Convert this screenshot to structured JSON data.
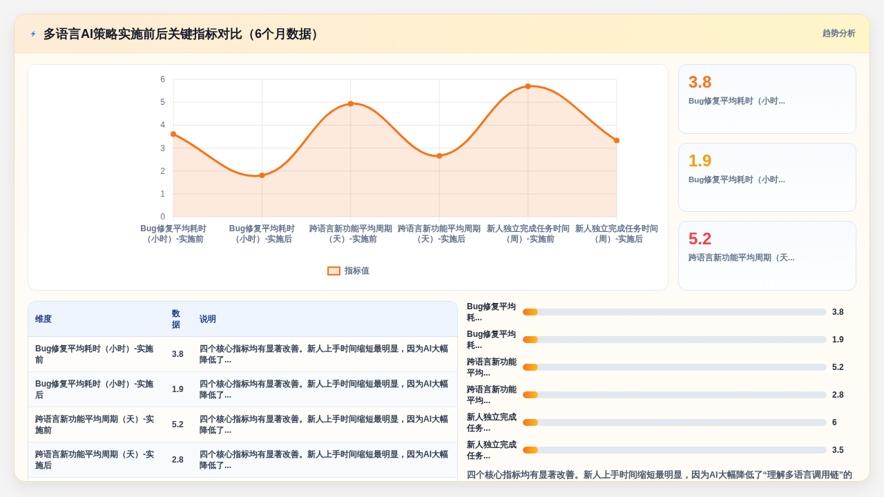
{
  "header": {
    "title": "多语言AI策略实施前后关键指标对比（6个月数据）",
    "tag": "趋势分析"
  },
  "chart": {
    "chart_data": {
      "type": "area",
      "categories": [
        "Bug修复平均耗时（小时）-实施前",
        "Bug修复平均耗时（小时）-实施后",
        "跨语言新功能平均周期（天）-实施前",
        "跨语言新功能平均周期（天）-实施后",
        "新人独立完成任务时间（周）-实施前",
        "新人独立完成任务时间（周）-实施后"
      ],
      "series": [
        {
          "name": "指标值",
          "color": "#f97316",
          "values": [
            3.61,
            1.81,
            4.94,
            2.66,
            5.7,
            3.33
          ]
        }
      ],
      "ylim": [
        0,
        6
      ],
      "yticks": [
        0,
        1,
        2,
        3,
        4,
        5,
        6
      ],
      "grid": true
    }
  },
  "kpis": [
    {
      "value": "3.8",
      "label": "Bug修复平均耗时（小时...",
      "color": "#f97316"
    },
    {
      "value": "1.9",
      "label": "Bug修复平均耗时（小时...",
      "color": "#f59e0b"
    },
    {
      "value": "5.2",
      "label": "跨语言新功能平均周期（天...",
      "color": "#ef4444"
    }
  ],
  "table": {
    "columns": [
      "维度",
      "数据",
      "说明"
    ],
    "rows": [
      {
        "dimension": "Bug修复平均耗时（小时）-实施前",
        "value": "3.8",
        "note": "四个核心指标均有显著改善。新人上手时间缩短最明显，因为AI大幅降低了..."
      },
      {
        "dimension": "Bug修复平均耗时（小时）-实施后",
        "value": "1.9",
        "note": "四个核心指标均有显著改善。新人上手时间缩短最明显，因为AI大幅降低了..."
      },
      {
        "dimension": "跨语言新功能平均周期（天）-实施前",
        "value": "5.2",
        "note": "四个核心指标均有显著改善。新人上手时间缩短最明显，因为AI大幅降低了..."
      },
      {
        "dimension": "跨语言新功能平均周期（天）-实施后",
        "value": "2.8",
        "note": "四个核心指标均有显著改善。新人上手时间缩短最明显，因为AI大幅降低了..."
      }
    ]
  },
  "bars": [
    {
      "label": "Bug修复平均耗...",
      "value": "3.8",
      "level": 0.05
    },
    {
      "label": "Bug修复平均耗...",
      "value": "1.9",
      "level": 0.05
    },
    {
      "label": "跨语言新功能平均...",
      "value": "5.2",
      "level": 0.05
    },
    {
      "label": "跨语言新功能平均...",
      "value": "2.8",
      "level": 0.05
    },
    {
      "label": "新人独立完成任务...",
      "value": "6",
      "level": 0.05
    },
    {
      "label": "新人独立完成任务...",
      "value": "3.5",
      "level": 0.05
    }
  ],
  "summary": "四个核心指标均有显著改善。新人上手时间缩短最明显，因为AI大幅降低了“理解多语言调用链”的"
}
